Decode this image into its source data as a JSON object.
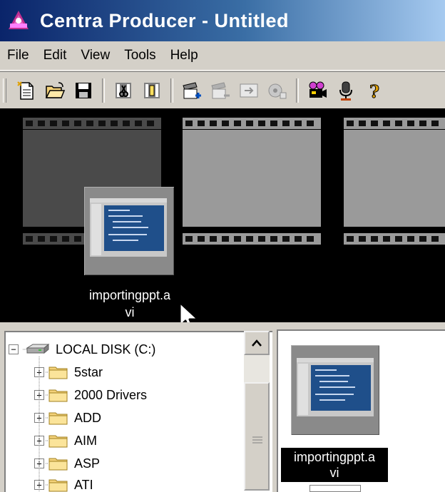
{
  "window": {
    "title": "Centra Producer - Untitled"
  },
  "menubar": {
    "items": [
      {
        "label": "File"
      },
      {
        "label": "Edit"
      },
      {
        "label": "View"
      },
      {
        "label": "Tools"
      },
      {
        "label": "Help"
      }
    ]
  },
  "toolbar": {
    "buttons": [
      {
        "icon": "new-document-icon"
      },
      {
        "icon": "open-folder-icon"
      },
      {
        "icon": "save-icon"
      },
      {
        "icon": "cut-clip-icon"
      },
      {
        "icon": "split-clip-icon"
      },
      {
        "icon": "add-slide-icon"
      },
      {
        "icon": "remove-slide-icon"
      },
      {
        "icon": "export-icon"
      },
      {
        "icon": "effects-icon"
      },
      {
        "icon": "video-camera-icon"
      },
      {
        "icon": "microphone-icon"
      },
      {
        "icon": "help-icon"
      }
    ]
  },
  "filmstrip": {
    "dragging_clip_label": "importingppt.a\nvi",
    "dragging_clip_label_line1": "importingppt.a",
    "dragging_clip_label_line2": "vi"
  },
  "file_tree": {
    "root": "LOCAL DISK (C:)",
    "folders": [
      "5star",
      "2000 Drivers",
      "ADD",
      "AIM",
      "ASP",
      "ATI"
    ]
  },
  "clip_bin": {
    "selected_clip_line1": "importingppt.a",
    "selected_clip_line2": "vi"
  },
  "colors": {
    "title_gradient_start": "#0a246a",
    "title_gradient_end": "#a6caf0",
    "film_background": "#000000",
    "frame_gray": "#9a9a9a",
    "folder_yellow": "#f4d27a"
  }
}
